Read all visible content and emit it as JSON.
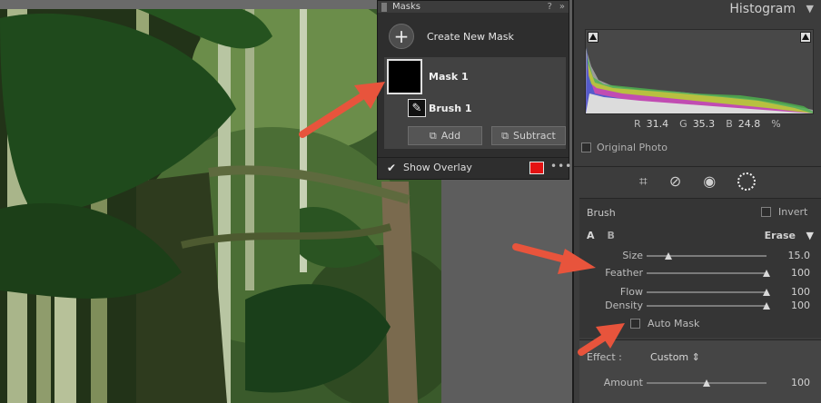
{
  "masks_panel": {
    "title": "Masks",
    "header_icons": [
      "help-icon",
      "expand-icon"
    ],
    "create_label": "Create New Mask",
    "mask_name": "Mask 1",
    "brush_name": "Brush 1",
    "add_label": "Add",
    "subtract_label": "Subtract",
    "show_overlay_label": "Show Overlay",
    "show_overlay_checked": true,
    "overlay_color": "#e31212"
  },
  "histogram": {
    "title": "Histogram",
    "r_label": "R",
    "r_value": "31.4",
    "g_label": "G",
    "g_value": "35.3",
    "b_label": "B",
    "b_value": "24.8",
    "percent": "%",
    "original_photo_label": "Original Photo"
  },
  "tools": [
    "crop-icon",
    "heal-icon",
    "red-eye-icon",
    "mask-icon"
  ],
  "brush": {
    "title": "Brush",
    "invert_label": "Invert",
    "a_label": "A",
    "b_label": "B",
    "erase_label": "Erase",
    "sliders": [
      {
        "label": "Size",
        "value": "15.0",
        "fraction": 0.18
      },
      {
        "label": "Feather",
        "value": "100",
        "fraction": 1.0
      },
      {
        "label": "Flow",
        "value": "100",
        "fraction": 1.0
      },
      {
        "label": "Density",
        "value": "100",
        "fraction": 1.0
      }
    ],
    "auto_mask_label": "Auto Mask"
  },
  "effect": {
    "label": "Effect :",
    "value": "Custom",
    "amount_label": "Amount",
    "amount_value": "100",
    "amount_fraction": 0.5
  },
  "annotation_color": "#e8543c"
}
